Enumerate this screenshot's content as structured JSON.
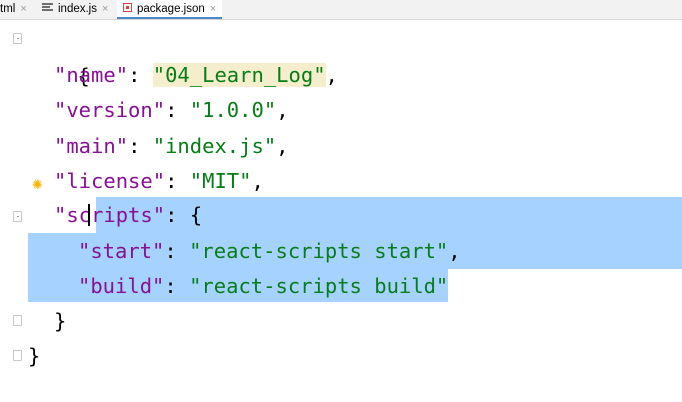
{
  "tabs": [
    {
      "label": "tml",
      "close": "×",
      "active": false
    },
    {
      "label": "index.js",
      "close": "×",
      "active": false
    },
    {
      "label": "package.json",
      "close": "×",
      "active": true
    }
  ],
  "code": {
    "open_brace": "{",
    "close_brace": "}",
    "name_key": "\"name\"",
    "name_value": "\"04_Learn_Log\"",
    "version_key": "\"version\"",
    "version_value": "\"1.0.0\"",
    "main_key": "\"main\"",
    "main_value": "\"index.js\"",
    "license_key": "\"license\"",
    "license_value": "\"MIT\"",
    "scripts_key_part1": "\"sc",
    "scripts_key_part2": "ripts\"",
    "scripts_open": ": {",
    "start_key": "\"start\"",
    "start_value": "\"react-scripts start\"",
    "build_key": "\"build\"",
    "build_value": "\"react-scripts build\"",
    "scripts_close": "}",
    "colon": ": ",
    "comma": ","
  },
  "colors": {
    "key": "#871094",
    "string": "#067d17",
    "selection": "#a6d2ff",
    "word_highlight": "#f5eecd"
  },
  "icons": {
    "intention": "lightbulb-icon"
  }
}
